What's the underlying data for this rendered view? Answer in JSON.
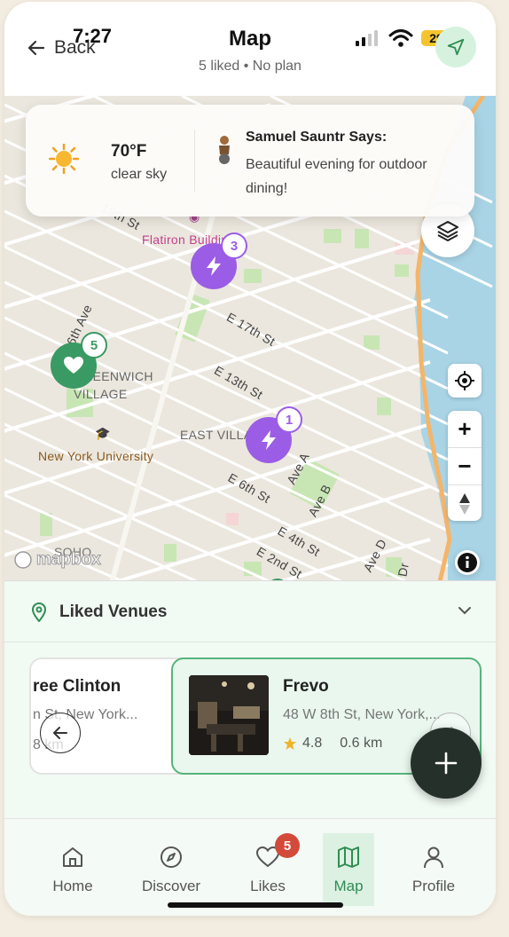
{
  "status": {
    "time": "7:27",
    "battery": "29"
  },
  "header": {
    "back_label": "Back",
    "title": "Map",
    "subtitle": "5 liked • No plan"
  },
  "weather": {
    "temperature": "70°F",
    "condition": "clear sky",
    "guide_title": "Samuel Sauntr Says:",
    "guide_text": "Beautiful evening for outdoor dining!"
  },
  "map": {
    "labels": {
      "flatiron": "Flatiron Building",
      "st19": "19th St",
      "ave6": "6th Ave",
      "st17": "E 17th St",
      "st13": "E 13th St",
      "greenwich": "GREENWICH",
      "village": "VILLAGE",
      "nyu": "New York University",
      "eastvillage": "EAST VILLAGE",
      "avea": "Ave A",
      "aveb": "Ave B",
      "st6": "E 6th St",
      "st4": "E 4th St",
      "st2": "E 2nd St",
      "aved": "Ave D",
      "soho": "SOHO",
      "dr": "Dr"
    },
    "markers": [
      {
        "count": "3",
        "type": "lightning"
      },
      {
        "count": "5",
        "type": "heart"
      },
      {
        "count": "1",
        "type": "lightning"
      }
    ],
    "attribution": "mapbox",
    "zoom_in": "+",
    "zoom_out": "−"
  },
  "sheet": {
    "title": "Liked Venues",
    "cards": [
      {
        "name": "ree Clinton",
        "address": "n St, New York...",
        "distance": "8 km"
      },
      {
        "name": "Frevo",
        "address": "48 W 8th St, New York,...",
        "rating": "4.8",
        "distance": "0.6 km"
      }
    ]
  },
  "tabs": [
    {
      "label": "Home",
      "icon": "home-icon"
    },
    {
      "label": "Discover",
      "icon": "compass-icon"
    },
    {
      "label": "Likes",
      "icon": "heart-icon",
      "badge": "5"
    },
    {
      "label": "Map",
      "icon": "map-icon",
      "active": true
    },
    {
      "label": "Profile",
      "icon": "profile-icon"
    }
  ],
  "colors": {
    "accent": "#2f8d53",
    "marker_purple": "#9b5de5",
    "marker_green": "#3a9a63",
    "badge_red": "#d44a3a"
  }
}
